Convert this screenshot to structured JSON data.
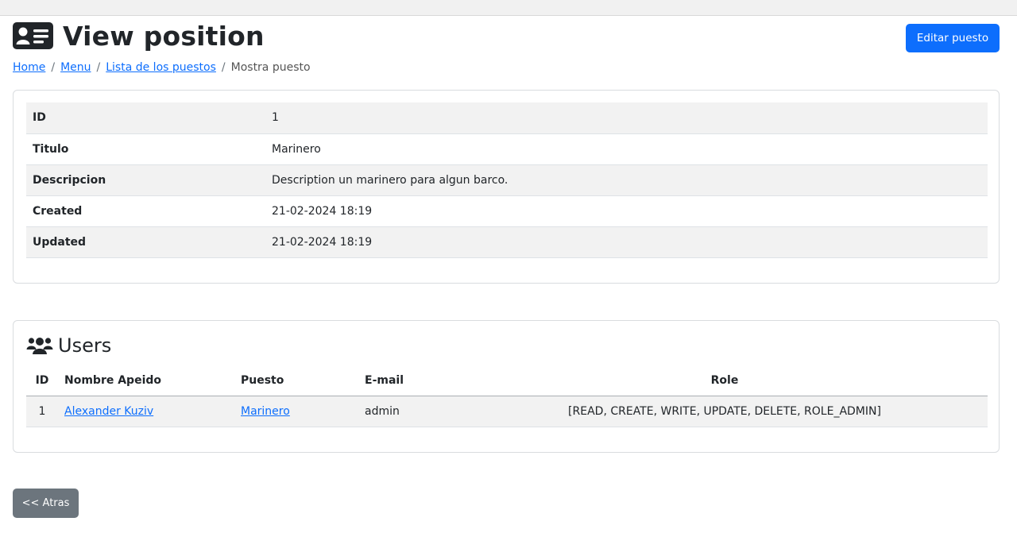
{
  "header": {
    "title": "View position",
    "edit_button": "Editar puesto"
  },
  "breadcrumb": {
    "items": [
      "Home",
      "Menu",
      "Lista de los puestos"
    ],
    "separator": "/",
    "current": "Mostra puesto"
  },
  "position": {
    "rows": [
      {
        "label": "ID",
        "value": "1"
      },
      {
        "label": "Titulo",
        "value": "Marinero"
      },
      {
        "label": "Descripcion",
        "value": "Description un marinero para algun barco."
      },
      {
        "label": "Created",
        "value": "21-02-2024 18:19"
      },
      {
        "label": "Updated",
        "value": "21-02-2024 18:19"
      }
    ]
  },
  "users": {
    "title": "Users",
    "columns": [
      "ID",
      "Nombre Apeido",
      "Puesto",
      "E-mail",
      "Role"
    ],
    "rows": [
      {
        "id": "1",
        "name": "Alexander Kuziv",
        "position": "Marinero",
        "email": "admin",
        "role": "[READ, CREATE, WRITE, UPDATE, DELETE, ROLE_ADMIN]"
      }
    ]
  },
  "footer": {
    "back_button": "<< Atras"
  },
  "icons": {
    "title_icon": "id-card-icon",
    "users_icon": "users-icon"
  },
  "colors": {
    "primary": "#0d6efd",
    "secondary": "#6c757d",
    "stripe": "#f2f2f2"
  }
}
